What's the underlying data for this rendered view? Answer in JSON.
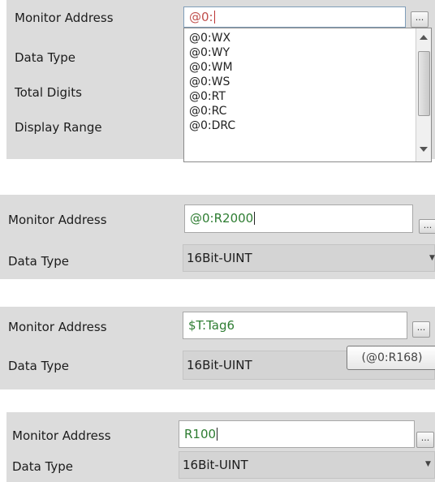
{
  "panel1": {
    "labels": [
      "Monitor Address",
      "Data Type",
      "Total Digits",
      "Display Range"
    ],
    "address_value": "@0:",
    "ellipsis": "...",
    "options": [
      "@0:WX",
      "@0:WY",
      "@0:WM",
      "@0:WS",
      "@0:RT",
      "@0:RC",
      "@0:DRC"
    ]
  },
  "panel2": {
    "address_label": "Monitor Address",
    "address_value": "@0:R2000",
    "ellipsis": "...",
    "type_label": "Data Type",
    "type_value": "16Bit-UINT"
  },
  "panel3": {
    "address_label": "Monitor Address",
    "address_value": "$T:Tag6",
    "ellipsis": "...",
    "type_label": "Data Type",
    "type_value": "16Bit-UINT",
    "tooltip": "(@0:R168)"
  },
  "panel4": {
    "address_label": "Monitor Address",
    "address_value": "R100",
    "ellipsis": "...",
    "type_label": "Data Type",
    "type_value": "16Bit-UINT"
  },
  "colors": {
    "panel_bg": "#dcdcdc",
    "red_text": "#c0504d",
    "green_text": "#2e7d32"
  }
}
